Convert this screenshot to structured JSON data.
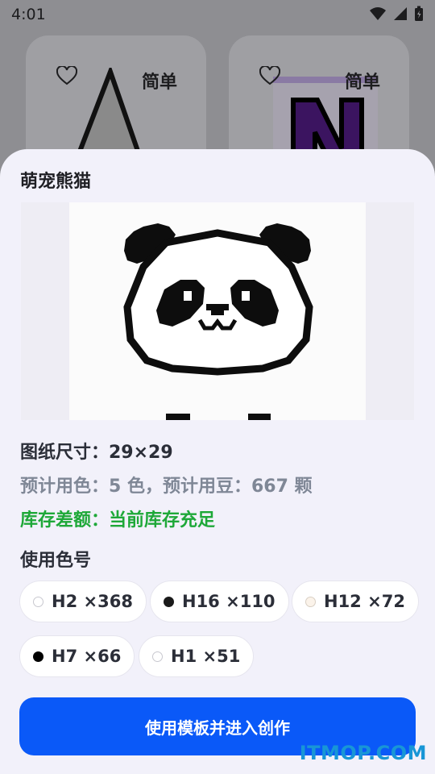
{
  "status_bar": {
    "time": "4:01"
  },
  "background_cards": [
    {
      "difficulty": "简单"
    },
    {
      "difficulty": "简单"
    }
  ],
  "sheet": {
    "title": "萌宠熊猫",
    "size_text": "图纸尺寸：29×29",
    "estimate_text": "预计用色：5 色，预计用豆：667 颗",
    "stock_text": "库存差额：当前库存充足",
    "colors_title": "使用色号",
    "colors": [
      {
        "label": "H2 ×368",
        "color": "#ffffff"
      },
      {
        "label": "H16 ×110",
        "color": "#1a1a1a"
      },
      {
        "label": "H12 ×72",
        "color": "#fbf3ea"
      },
      {
        "label": "H7 ×66",
        "color": "#000000"
      },
      {
        "label": "H1 ×51",
        "color": "#ffffff"
      }
    ],
    "primary_button": "使用模板并进入创作"
  },
  "watermark": "ITMOP.COM",
  "colors": {
    "accent": "#0a59f8",
    "stock_ok": "#1ea838",
    "sheet_bg": "#f2f1fa"
  }
}
